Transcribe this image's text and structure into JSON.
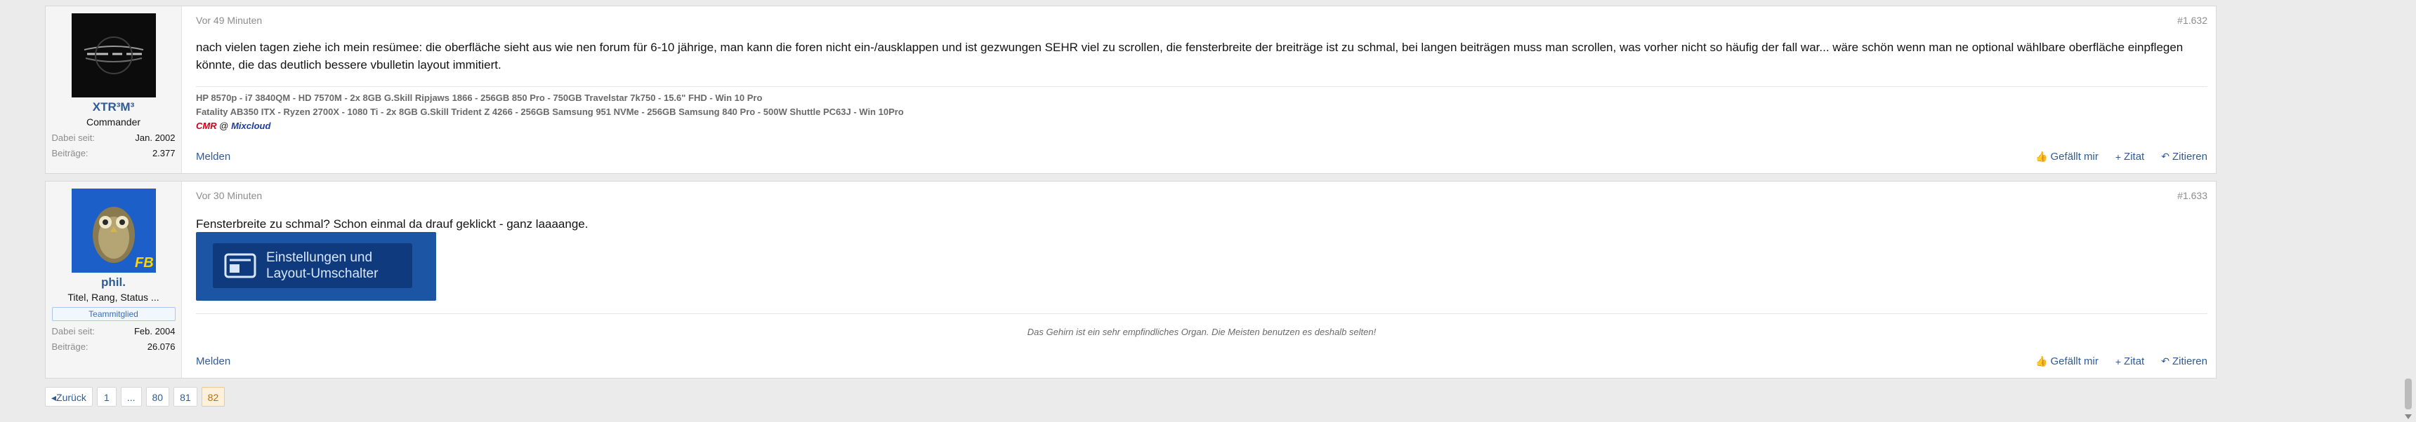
{
  "posts": [
    {
      "user": {
        "name": "XTR³M³",
        "title": "Commander"
      },
      "extra": [
        {
          "k": "Dabei seit:",
          "v": "Jan. 2002"
        },
        {
          "k": "Beiträge:",
          "v": "2.377"
        }
      ],
      "time": "Vor 49 Minuten",
      "number": "#1.632",
      "content": "nach vielen tagen ziehe ich mein resümee: die oberfläche sieht aus wie nen forum für 6-10 jährige, man kann die foren nicht ein-/ausklappen und ist gezwungen SEHR viel zu scrollen, die fensterbreite der breiträge ist zu schmal, bei langen beiträgen muss man scrollen, was vorher nicht so häufig der fall war... wäre schön wenn man ne optional wählbare oberfläche einpflegen könnte, die das deutlich bessere vbulletin layout immitiert.",
      "sig": {
        "line1": "HP 8570p - i7 3840QM - HD 7570M - 2x 8GB G.Skill Ripjaws 1866 - 256GB 850 Pro - 750GB Travelstar 7k750 - 15.6\" FHD - Win 10 Pro",
        "line2": "Fatality AB350 ITX - Ryzen 2700X - 1080 Ti - 2x 8GB G.Skill Trident Z 4266 - 256GB Samsung 951 NVMe - 256GB Samsung 840 Pro - 500W Shuttle PC63J - Win 10Pro",
        "cmr": "CMR",
        "at": "@",
        "mix": "Mixcloud"
      },
      "actions": {
        "report": "Melden",
        "like": "Gefällt mir",
        "quote": "Zitat",
        "reply": "Zitieren"
      }
    },
    {
      "user": {
        "name": "phil.",
        "title": "Titel, Rang, Status ...",
        "banner": "Teammitglied"
      },
      "extra": [
        {
          "k": "Dabei seit:",
          "v": "Feb. 2004"
        },
        {
          "k": "Beiträge:",
          "v": "26.076"
        }
      ],
      "time": "Vor 30 Minuten",
      "number": "#1.633",
      "content": "Fensterbreite zu schmal? Schon einmal da drauf geklickt - ganz laaaange.",
      "image_text": {
        "line1": "Einstellungen und",
        "line2": "Layout-Umschalter"
      },
      "sig": "Das Gehirn ist ein sehr empfindliches Organ. Die Meisten benutzen es deshalb selten!",
      "actions": {
        "report": "Melden",
        "like": "Gefällt mir",
        "quote": "Zitat",
        "reply": "Zitieren"
      }
    }
  ],
  "pagination": {
    "back": "Zurück",
    "pages": [
      "1",
      "...",
      "80",
      "81",
      "82"
    ],
    "current": "82"
  },
  "colors": {
    "link": "#2f5b97",
    "active_page_bg": "#fdf1dc",
    "cmr": "#d0021b",
    "mixcloud": "#1b3fa0"
  }
}
